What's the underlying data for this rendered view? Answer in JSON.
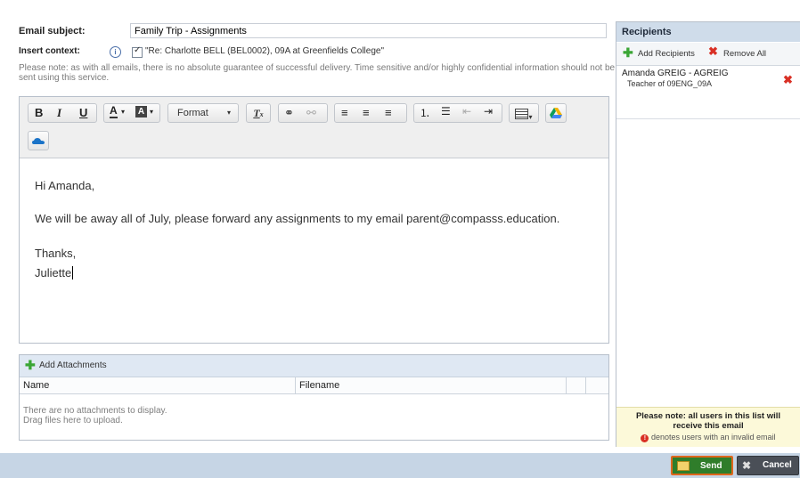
{
  "form": {
    "subject_label": "Email subject:",
    "subject_value": "Family Trip - Assignments",
    "context_label": "Insert context:",
    "context_value": "\"Re: Charlotte BELL (BEL0002), 09A at Greenfields College\"",
    "context_checked": true,
    "note": "Please note: as with all emails, there is no absolute guarantee of successful delivery. Time sensitive and/or highly confidential information should not be sent using this service."
  },
  "toolbar": {
    "bold": "B",
    "italic": "I",
    "underline": "U",
    "text_color": "A",
    "bg_color": "A",
    "format_label": "Format",
    "remove_format": "Tx",
    "icons": [
      "bold-icon",
      "italic-icon",
      "underline-icon",
      "text-color-icon",
      "background-color-icon",
      "remove-format-icon",
      "link-icon",
      "unlink-icon",
      "align-left-icon",
      "align-center-icon",
      "align-right-icon",
      "numbered-list-icon",
      "bulleted-list-icon",
      "decrease-indent-icon",
      "increase-indent-icon",
      "table-icon",
      "google-drive-icon",
      "onedrive-icon"
    ]
  },
  "message": {
    "greeting": "Hi Amanda,",
    "body": "We will be away all of July, please forward any assignments to my email parent@compasss.education.",
    "closing": "Thanks,",
    "signature": "Juliette"
  },
  "attachments": {
    "add_label": "Add Attachments",
    "columns": [
      "Name",
      "Filename"
    ],
    "empty_line1": "There are no attachments to display.",
    "empty_line2": "Drag files here to upload."
  },
  "recipients": {
    "title": "Recipients",
    "add_label": "Add Recipients",
    "remove_all_label": "Remove All",
    "items": [
      {
        "name": "Amanda GREIG - AGREIG",
        "role": "Teacher of 09ENG_09A"
      }
    ],
    "note_title": "Please note: all users in this list will receive this email",
    "note_invalid": "denotes users with an invalid email"
  },
  "footer": {
    "send_label": "Send",
    "cancel_label": "Cancel"
  },
  "colors": {
    "accent_green": "#3aa635",
    "remove_red": "#d93025",
    "header_blue": "#cfdcea",
    "footer_blue": "#c6d5e5",
    "send_border": "#e0661d"
  }
}
